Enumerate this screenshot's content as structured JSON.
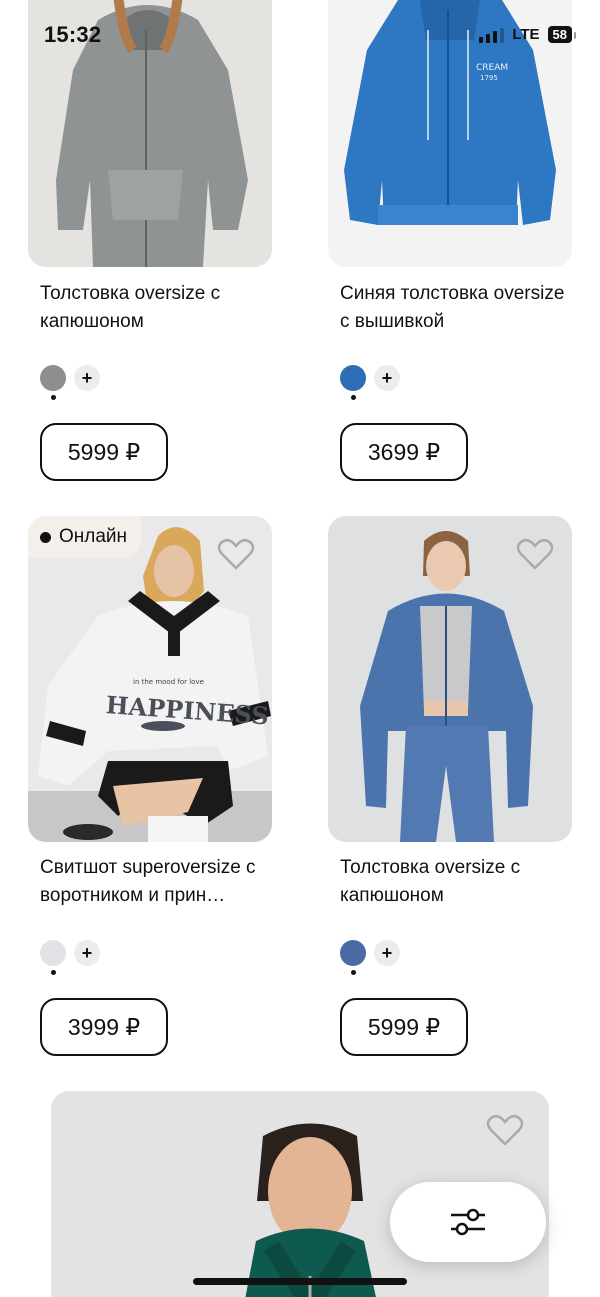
{
  "status_bar": {
    "time": "15:32",
    "network": "LTE",
    "battery": "58"
  },
  "products": [
    {
      "title": "Толстовка oversize с капюшоном",
      "price": "5999 ₽",
      "swatch_color": "#8e8e8e",
      "photo": "grey-hoodie-photo"
    },
    {
      "title": "Синяя толстовка oversize с вышивкой",
      "price": "3699 ₽",
      "swatch_color": "#2f6db5",
      "photo": "blue-hoodie-photo"
    },
    {
      "title": "Свитшот superoversize с воротником и прин…",
      "price": "3999 ₽",
      "swatch_color": "#e1e2e6",
      "photo": "white-sweatshirt-photo",
      "badge": "Онлайн"
    },
    {
      "title": "Толстовка oversize с капюшоном",
      "price": "5999 ₽",
      "swatch_color": "#4a6aa8",
      "photo": "denim-hoodie-photo"
    }
  ],
  "sweatshirt_print": {
    "tagline": "in the mood for love",
    "word": "HAPPINESS"
  },
  "colors": {
    "text": "#111111",
    "badge_bg": "#f4efe9",
    "plus_bg": "#ececec"
  },
  "icons": {
    "heart": "heart-outline-icon",
    "filter": "sliders-icon",
    "plus": "plus-icon"
  },
  "plus_label": "+"
}
